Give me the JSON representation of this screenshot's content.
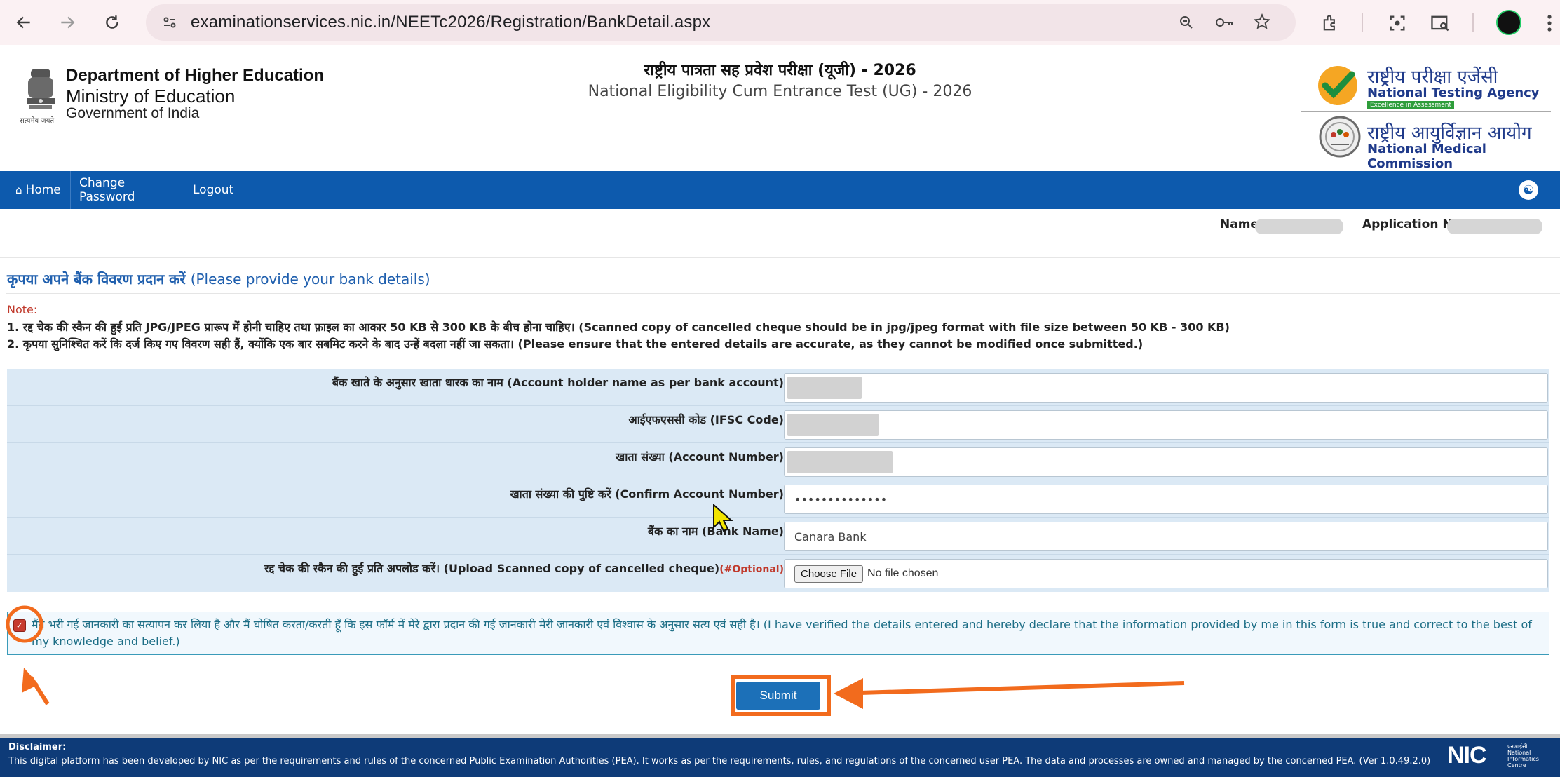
{
  "browser": {
    "url": "examinationservices.nic.in/NEETc2026/Registration/BankDetail.aspx"
  },
  "header": {
    "dept_line1": "Department of Higher Education",
    "dept_line2": "Ministry of Education",
    "dept_line3": "Government of India",
    "emblem_caption": "सत्यमेव जयते",
    "exam_title_hi": "राष्ट्रीय पात्रता सह प्रवेश परीक्षा (यूजी) - 2026",
    "exam_title_en": "National Eligibility Cum Entrance Test (UG) - 2026",
    "nta_hi": "राष्ट्रीय परीक्षा एजेंसी",
    "nta_en": "National Testing Agency",
    "nta_tagline": "Excellence in Assessment",
    "nmc_hi": "राष्ट्रीय आयुर्विज्ञान आयोग",
    "nmc_en": "National Medical Commission"
  },
  "navbar": {
    "home": "Home",
    "change_password": "Change Password",
    "logout": "Logout"
  },
  "user": {
    "name_label": "Name",
    "application_label": "Application No"
  },
  "page": {
    "title_hi": "कृपया अपने बैंक विवरण प्रदान करें",
    "title_en": "(Please provide your bank details)",
    "note_label": "Note:",
    "note_1": "1. रद्द चेक की स्कैन की हुई प्रति JPG/JPEG प्रारूप में होनी चाहिए तथा फ़ाइल का आकार 50 KB से 300 KB के बीच होना चाहिए। (Scanned copy of cancelled cheque should be in jpg/jpeg format with file size between 50 KB - 300 KB)",
    "note_2": "2. कृपया सुनिश्चित करें कि दर्ज किए गए विवरण सही हैं, क्योंकि एक बार सबमिट करने के बाद उन्हें बदला नहीं जा सकता। (Please ensure that the entered details are accurate, as they cannot be modified once submitted.)"
  },
  "form": {
    "account_holder_label": "बैंक खाते के अनुसार खाता धारक का नाम (Account holder name as per bank account)",
    "ifsc_label": "आईएफएससी कोड (IFSC Code)",
    "account_number_label": "खाता संख्या (Account Number)",
    "confirm_account_label": "खाता संख्या की पुष्टि करें (Confirm Account Number)",
    "confirm_account_value": "••••••••••••••",
    "bank_name_label": "बैंक का नाम (Bank Name)",
    "bank_name_value": "Canara Bank",
    "upload_label": "रद्द चेक की स्कैन की हुई प्रति अपलोड करें। (Upload Scanned copy of cancelled cheque)",
    "upload_optional": "(#Optional)",
    "choose_file": "Choose File",
    "no_file": "No file chosen"
  },
  "declaration": {
    "checked": true,
    "text": "मैंने भरी गई जानकारी का सत्यापन कर लिया है और मैं घोषित करता/करती हूँ कि इस फॉर्म में मेरे द्वारा प्रदान की गई जानकारी मेरी जानकारी एवं विश्वास के अनुसार सत्य एवं सही है। (I have verified the details entered and hereby declare that the information provided by me in this form is true and correct to the best of my knowledge and belief.)"
  },
  "submit": {
    "label": "Submit"
  },
  "footer": {
    "disclaimer_title": "Disclaimer:",
    "disclaimer_text": "This digital platform has been developed by NIC as per the requirements and rules of the concerned Public Examination Authorities (PEA). It works as per the requirements, rules, and regulations of the concerned user PEA. The data and processes are owned and managed by the concerned PEA. (Ver 1.0.49.2.0)",
    "nic_logo": "NIC",
    "nic_sub_hi": "एनआईसी",
    "nic_sub_en": "National Informatics Centre"
  },
  "colors": {
    "navbar": "#0d5aad",
    "form_bg": "#dbe9f5",
    "annotation": "#f26b1d",
    "footer": "#0e3b78"
  }
}
